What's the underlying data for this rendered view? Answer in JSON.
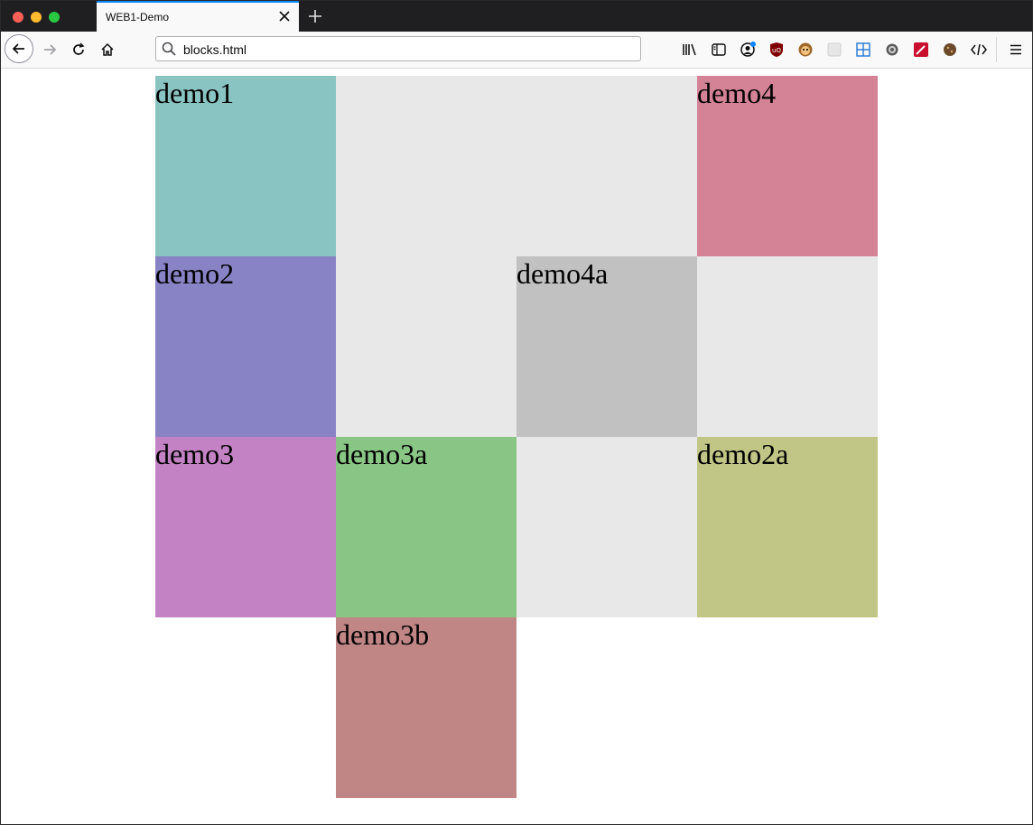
{
  "browser": {
    "tab_title": "WEB1-Demo",
    "url": "blocks.html"
  },
  "blocks": {
    "demo1": {
      "label": "demo1",
      "color": "#8ac4c2"
    },
    "demo2": {
      "label": "demo2",
      "color": "#8883c4"
    },
    "demo3": {
      "label": "demo3",
      "color": "#c382c4"
    },
    "demo3a": {
      "label": "demo3a",
      "color": "#89c685"
    },
    "demo3b": {
      "label": "demo3b",
      "color": "#c08585"
    },
    "demo4": {
      "label": "demo4",
      "color": "#d48397"
    },
    "demo4a": {
      "label": "demo4a",
      "color": "#c1c1c1"
    },
    "demo2a": {
      "label": "demo2a",
      "color": "#c1c585"
    },
    "filler_color": "#e8e8e8"
  },
  "toolbar_icons": [
    "library-icon",
    "sidebar-icon",
    "account-icon",
    "ublock-icon",
    "tampermonkey-icon",
    "extension-icon",
    "grid-icon",
    "gear-icon",
    "wand-icon",
    "cookie-icon",
    "code-icon",
    "menu-icon"
  ]
}
